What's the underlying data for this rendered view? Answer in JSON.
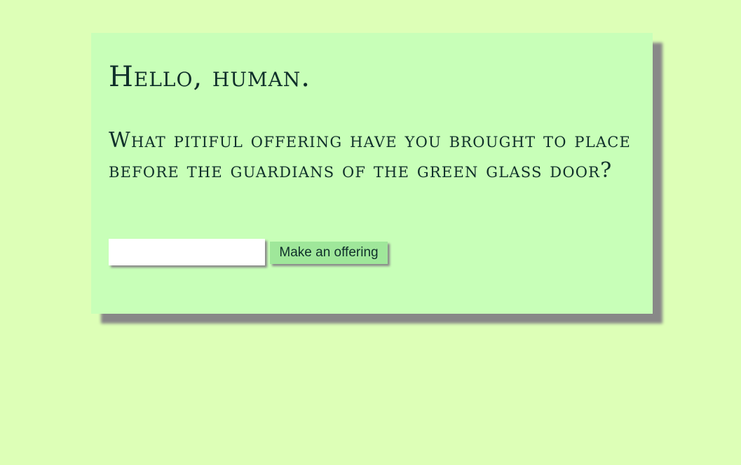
{
  "card": {
    "greeting": "Hello, human.",
    "question": "What pitiful offering have you brought to place before the guardians of the green glass door?"
  },
  "form": {
    "input_value": "",
    "input_placeholder": "",
    "button_label": "Make an offering"
  },
  "colors": {
    "background": "#ddffb7",
    "card": "#c8ffb8",
    "button": "#9fe79a",
    "text": "#0f2f2a"
  }
}
